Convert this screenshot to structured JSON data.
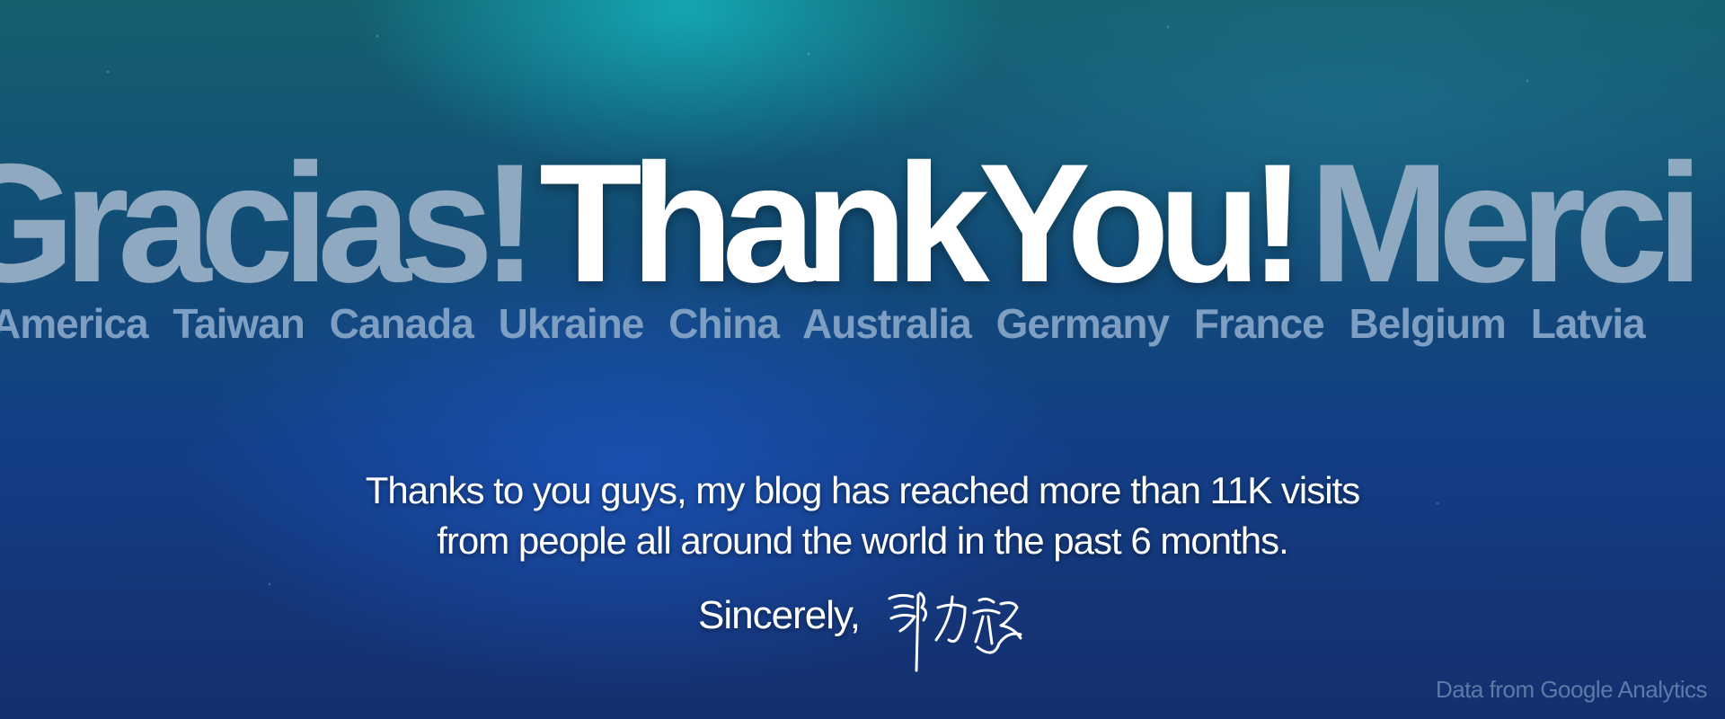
{
  "headline": {
    "left_word": "Gracias!",
    "center_word": "ThankYou!",
    "right_word": "Merci"
  },
  "countries": [
    "America",
    "Taiwan",
    "Canada",
    "Ukraine",
    "China",
    "Australia",
    "Germany",
    "France",
    "Belgium",
    "Latvia"
  ],
  "message": {
    "line1": "Thanks to you guys, my blog has reached more than 11K visits",
    "line2": "from people all around the world in the past 6 months."
  },
  "signoff": "Sincerely,",
  "signature_text": "郭力銘",
  "source_note": "Data from Google Analytics",
  "colors": {
    "headline_primary": "#ffffff",
    "headline_secondary": "#8fa9c1",
    "countries": "#7f9fc2",
    "source_note": "#5c7aa8"
  }
}
